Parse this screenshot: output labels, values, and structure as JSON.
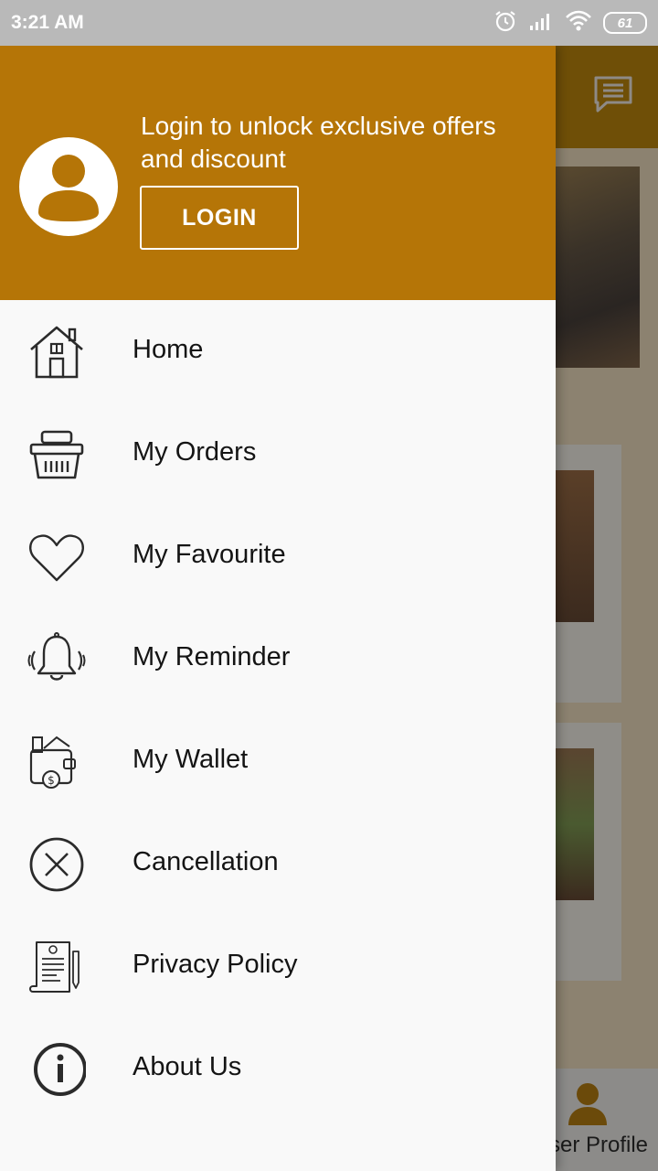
{
  "status_bar": {
    "time": "3:21 AM",
    "battery": "61"
  },
  "drawer": {
    "header": {
      "message": "Login to unlock exclusive offers and discount",
      "login_label": "LOGIN"
    },
    "menu_items": [
      {
        "label": "Home",
        "icon": "home-icon"
      },
      {
        "label": "My Orders",
        "icon": "basket-icon"
      },
      {
        "label": "My Favourite",
        "icon": "heart-icon"
      },
      {
        "label": "My Reminder",
        "icon": "bell-icon"
      },
      {
        "label": "My Wallet",
        "icon": "wallet-icon"
      },
      {
        "label": "Cancellation",
        "icon": "cancel-icon"
      },
      {
        "label": "Privacy Policy",
        "icon": "document-icon"
      },
      {
        "label": "About Us",
        "icon": "info-icon"
      }
    ]
  },
  "background": {
    "bottom_nav_label": "ser Profile"
  },
  "colors": {
    "header": "#b57507",
    "drawer_bg": "#f9f9f9",
    "status_bar": "#b9b9b9"
  }
}
